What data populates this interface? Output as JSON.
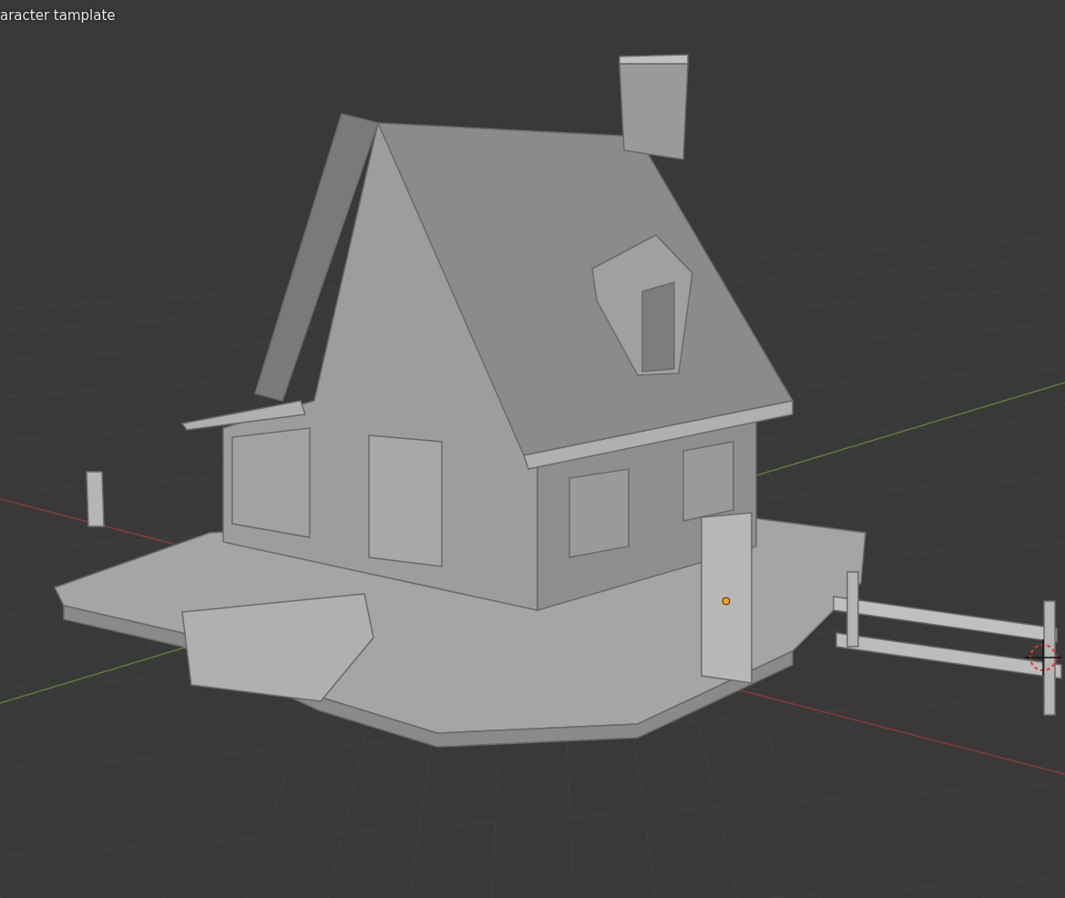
{
  "viewport": {
    "view_name": "aracter tamplate"
  }
}
